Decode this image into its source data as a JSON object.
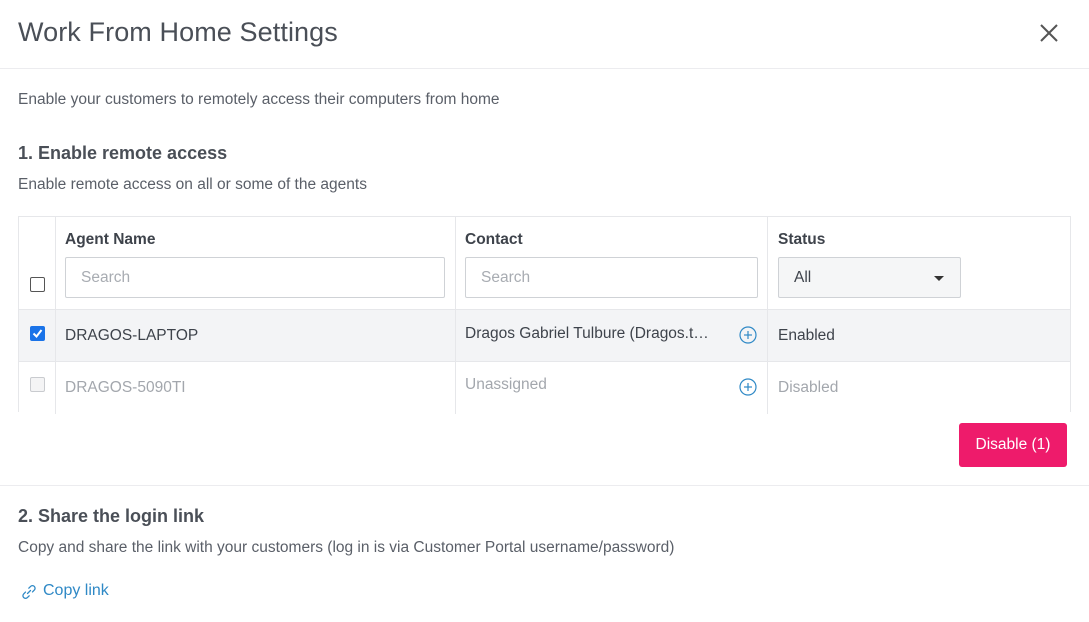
{
  "dialog": {
    "title": "Work From Home Settings",
    "intro": "Enable your customers to remotely access their computers from home"
  },
  "section1": {
    "title": "1. Enable remote access",
    "description": "Enable remote access on all or some of the agents"
  },
  "table": {
    "columns": {
      "agent_name": "Agent Name",
      "contact": "Contact",
      "status": "Status"
    },
    "filters": {
      "agent_placeholder": "Search",
      "contact_placeholder": "Search",
      "status_value": "All"
    },
    "rows": [
      {
        "agent": "DRAGOS-LAPTOP",
        "contact": "Dragos Gabriel Tulbure (Dragos.t…",
        "status": "Enabled",
        "checked": true
      },
      {
        "agent": "DRAGOS-5090TI",
        "contact": "Unassigned",
        "status": "Disabled",
        "checked": false
      }
    ]
  },
  "actions": {
    "disable_label": "Disable (1)"
  },
  "section2": {
    "title": "2. Share the login link",
    "description": "Copy and share the link with your customers (log in is via Customer Portal username/password)",
    "copy_link_label": "Copy link"
  },
  "colors": {
    "accent": "#ee1b6b",
    "link": "#2f89c6",
    "checkbox": "#1a73e8"
  },
  "icons": {
    "close": "close-icon",
    "caret": "chevron-down-icon",
    "add_contact": "plus-circle-icon",
    "copy": "link-icon"
  }
}
